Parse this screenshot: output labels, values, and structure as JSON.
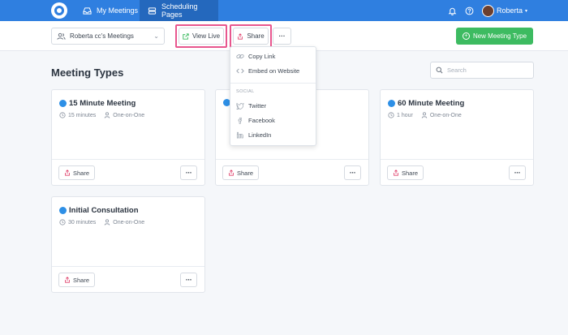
{
  "nav": {
    "tabs": [
      {
        "label": "My Meetings",
        "icon": "inbox-icon"
      },
      {
        "label": "Scheduling Pages",
        "icon": "layers-icon"
      }
    ],
    "user": {
      "name": "Roberta"
    }
  },
  "toolbar": {
    "calendar_select": "Roberta cc's Meetings",
    "view_live_label": "View Live",
    "share_label": "Share",
    "more_label": "···",
    "new_meeting_type_label": "New Meeting Type"
  },
  "page": {
    "title": "Meeting Types",
    "search_placeholder": "Search"
  },
  "cards": [
    {
      "title": "15 Minute Meeting",
      "duration": "15 minutes",
      "type": "One-on-One",
      "share_label": "Share",
      "more_label": "···"
    },
    {
      "title": "",
      "duration": "",
      "type": "",
      "share_label": "Share",
      "more_label": "···"
    },
    {
      "title": "60 Minute Meeting",
      "duration": "1 hour",
      "type": "One-on-One",
      "share_label": "Share",
      "more_label": "···"
    },
    {
      "title": "Initial Consultation",
      "duration": "30 minutes",
      "type": "One-on-One",
      "share_label": "Share",
      "more_label": "···"
    }
  ],
  "share_menu": {
    "copy_link": "Copy Link",
    "embed": "Embed on Website",
    "social_heading": "SOCIAL",
    "twitter": "Twitter",
    "facebook": "Facebook",
    "linkedin": "LinkedIn"
  },
  "colors": {
    "nav_blue": "#2f7fe0",
    "primary_green": "#3dbb61",
    "highlight_pink": "#e8568e",
    "dot_blue": "#2d8fe6"
  }
}
